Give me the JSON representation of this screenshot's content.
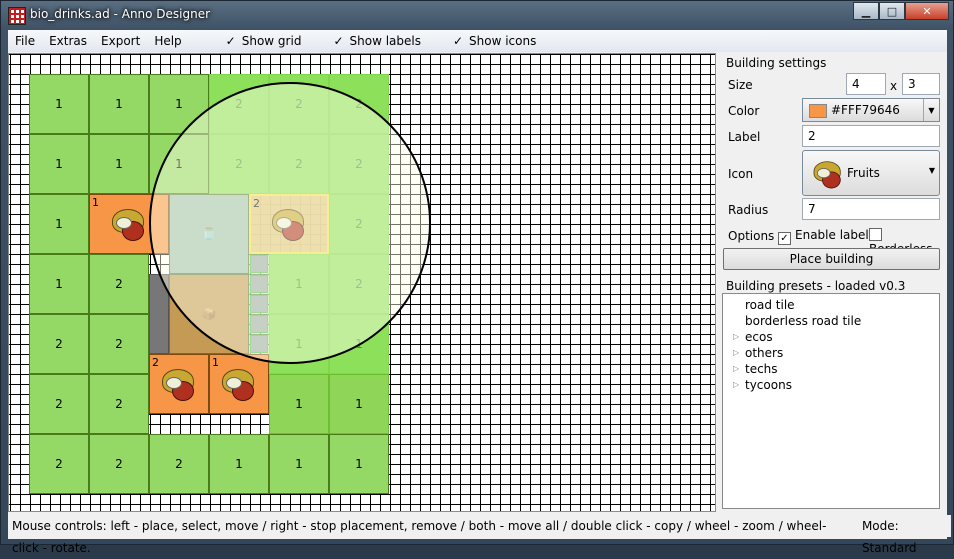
{
  "window": {
    "title": "bio_drinks.ad - Anno Designer",
    "minimize": "▁",
    "maximize": "□",
    "close": "✕"
  },
  "menu": {
    "file": "File",
    "extras": "Extras",
    "export": "Export",
    "help": "Help",
    "show_grid": "Show grid",
    "show_labels": "Show labels",
    "show_icons": "Show icons",
    "check": "✓"
  },
  "canvas": {
    "grid_labels": [
      [
        "1",
        "1",
        "1",
        "2",
        "2",
        "2"
      ],
      [
        "1",
        "1",
        "1",
        "2",
        "2",
        "2"
      ],
      [
        "1",
        "",
        "",
        "",
        "",
        "2"
      ],
      [
        "1",
        "2",
        "",
        "",
        "1",
        "2"
      ],
      [
        "2",
        "2",
        "",
        "",
        "1",
        "1"
      ],
      [
        "2",
        "2",
        "",
        "",
        "1",
        "1"
      ],
      [
        "2",
        "2",
        "2",
        "1",
        "1",
        "1"
      ]
    ],
    "fruit_labels": {
      "left": "1",
      "selected": "2",
      "bottom_a": "2",
      "bottom_b": "1"
    }
  },
  "settings": {
    "title": "Building settings",
    "size_label": "Size",
    "size_w": "4",
    "size_x": "x",
    "size_h": "3",
    "color_label": "Color",
    "color_value": "#FFF79646",
    "color_swatch": "#f79646",
    "label_label": "Label",
    "label_value": "2",
    "icon_label": "Icon",
    "icon_value": "Fruits",
    "radius_label": "Radius",
    "radius_value": "7",
    "options_label": "Options",
    "enable_label": "Enable label",
    "borderless": "Borderless",
    "place_button": "Place building"
  },
  "presets": {
    "title": "Building presets - loaded v0.3",
    "items": [
      "road tile",
      "borderless road tile",
      "ecos",
      "others",
      "techs",
      "tycoons"
    ]
  },
  "status": {
    "controls": "Mouse controls: left - place, select, move / right - stop placement, remove / both - move all / double click - copy / wheel - zoom / wheel-click - rotate.",
    "mode": "Mode: Standard"
  }
}
